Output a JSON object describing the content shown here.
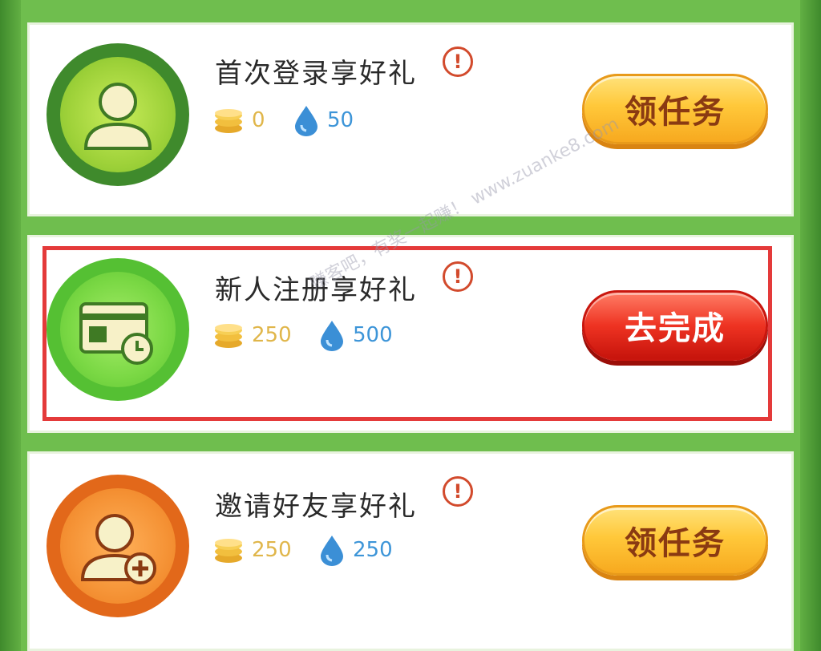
{
  "tasks": [
    {
      "title": "首次登录享好礼",
      "coins": "0",
      "water": "50",
      "button": "领任务",
      "button_style": "yellow",
      "icon": "user-icon",
      "theme": "#5bb52c"
    },
    {
      "title": "新人注册享好礼",
      "coins": "250",
      "water": "500",
      "button": "去完成",
      "button_style": "red",
      "icon": "id-card-clock-icon",
      "theme": "#6fd14a",
      "highlighted": true
    },
    {
      "title": "邀请好友享好礼",
      "coins": "250",
      "water": "250",
      "button": "领任务",
      "button_style": "yellow",
      "icon": "add-user-icon",
      "theme": "#f07d1d"
    }
  ],
  "alert_symbol": "!",
  "watermark": "赚客吧，有奖一起赚！ www.zuanke8.com"
}
